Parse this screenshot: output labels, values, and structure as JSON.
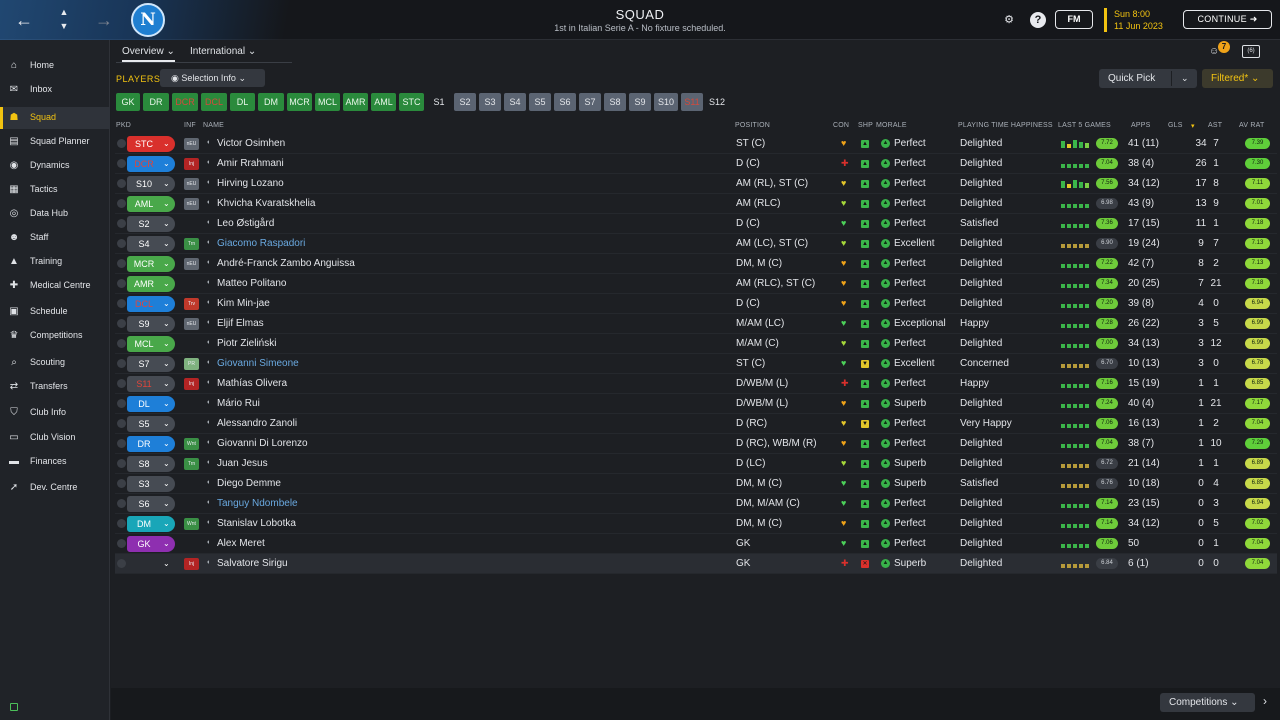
{
  "header": {
    "title": "SQUAD",
    "subtitle": "1st in Italian Serie A - No fixture scheduled.",
    "club_badge": "N",
    "fm_label": "FM",
    "date_time": "Sun 8:00",
    "date_day": "11 Jun 2023",
    "continue_label": "CONTINUE",
    "icons": [
      "back-arrow-icon",
      "up-down-icon",
      "forward-arrow-icon",
      "settings-icon",
      "help-icon"
    ]
  },
  "sidebar": {
    "items": [
      {
        "label": "Home",
        "icon": "⌂"
      },
      {
        "label": "Inbox",
        "icon": "✉"
      },
      {
        "label": "Squad",
        "icon": "☗"
      },
      {
        "label": "Squad Planner",
        "icon": "▤"
      },
      {
        "label": "Dynamics",
        "icon": "◉"
      },
      {
        "label": "Tactics",
        "icon": "▦"
      },
      {
        "label": "Data Hub",
        "icon": "◎"
      },
      {
        "label": "Staff",
        "icon": "☻"
      },
      {
        "label": "Training",
        "icon": "▲"
      },
      {
        "label": "Medical Centre",
        "icon": "✚"
      },
      {
        "label": "Schedule",
        "icon": "▣"
      },
      {
        "label": "Competitions",
        "icon": "♛"
      },
      {
        "label": "Scouting",
        "icon": "⌕"
      },
      {
        "label": "Transfers",
        "icon": "⇄"
      },
      {
        "label": "Club Info",
        "icon": "⛉"
      },
      {
        "label": "Club Vision",
        "icon": "▭"
      },
      {
        "label": "Finances",
        "icon": "▬"
      },
      {
        "label": "Dev. Centre",
        "icon": "➚"
      }
    ],
    "active": "Squad"
  },
  "tabs": {
    "overview": "Overview",
    "international": "International",
    "caret": "⌄"
  },
  "toolbar": {
    "players_label": "PLAYERS",
    "selection_info": "Selection Info",
    "quick_pick": "Quick Pick",
    "filtered": "Filtered*",
    "notification_count": "7",
    "view_label": "(6)"
  },
  "chips": [
    {
      "label": "GK",
      "style": "g"
    },
    {
      "label": "DR",
      "style": "g"
    },
    {
      "label": "DCR",
      "style": "r"
    },
    {
      "label": "DCL",
      "style": "r"
    },
    {
      "label": "DL",
      "style": "g"
    },
    {
      "label": "DM",
      "style": "g"
    },
    {
      "label": "MCR",
      "style": "g"
    },
    {
      "label": "MCL",
      "style": "g"
    },
    {
      "label": "AMR",
      "style": "g"
    },
    {
      "label": "AML",
      "style": "g"
    },
    {
      "label": "STC",
      "style": "g"
    },
    {
      "label": "S1",
      "style": "t"
    },
    {
      "label": "S2",
      "style": "s"
    },
    {
      "label": "S3",
      "style": "s"
    },
    {
      "label": "S4",
      "style": "s"
    },
    {
      "label": "S5",
      "style": "s"
    },
    {
      "label": "S6",
      "style": "s"
    },
    {
      "label": "S7",
      "style": "s"
    },
    {
      "label": "S8",
      "style": "s"
    },
    {
      "label": "S9",
      "style": "s"
    },
    {
      "label": "S10",
      "style": "s"
    },
    {
      "label": "S11",
      "style": "sr"
    },
    {
      "label": "S12",
      "style": "t"
    }
  ],
  "columns": {
    "pkd": "PKD",
    "inf": "INF",
    "name": "NAME",
    "position": "POSITION",
    "con": "CON",
    "shp": "SHP",
    "morale": "MORALE",
    "pth": "PLAYING TIME HAPPINESS",
    "last5": "LAST 5 GAMES",
    "apps": "APPS",
    "gls": "GLS",
    "gls_sort": "▾",
    "ast": "AST",
    "avrat": "AV RAT"
  },
  "colors": {
    "accent_yellow": "#f2c311",
    "pill_red": "#d9302c",
    "pill_green": "#49a84a",
    "pill_blue": "#1e7fd8",
    "pill_grey": "#464b53",
    "pill_teal": "#19a6b8",
    "pill_purple": "#8e2fb0",
    "morale_green": "#38b24a"
  },
  "players": [
    {
      "pkd": "STC",
      "pill": "red",
      "inf": "nEU",
      "inf_c": "#5f6670",
      "name": "Victor Osimhen",
      "loan": false,
      "position": "ST (C)",
      "con": "heart-orange",
      "shp": "up-green",
      "morale": "Perfect",
      "pth": "Delighted",
      "form": "mixed",
      "last5": "7.72",
      "apps": "41 (11)",
      "gls": "34",
      "ast": "7",
      "avrat": "7.39",
      "av_c": "#5fcf3a"
    },
    {
      "pkd": "DCR",
      "pill": "blue-red",
      "inf": "Inj",
      "inf_c": "#b32424",
      "name": "Amir Rrahmani",
      "loan": false,
      "position": "D (C)",
      "con": "cross-red",
      "shp": "up-green",
      "morale": "Perfect",
      "pth": "Delighted",
      "form": "good",
      "last5": "7.04",
      "apps": "38 (4)",
      "gls": "26",
      "ast": "1",
      "avrat": "7.30",
      "av_c": "#5fcf3a"
    },
    {
      "pkd": "S10",
      "pill": "grey",
      "inf": "nEU",
      "inf_c": "#5f6670",
      "name": "Hirving Lozano",
      "loan": false,
      "position": "AM (RL), ST (C)",
      "con": "heart-yellow",
      "shp": "up-green",
      "morale": "Perfect",
      "pth": "Delighted",
      "form": "mixed",
      "last5": "7.56",
      "apps": "34 (12)",
      "gls": "17",
      "ast": "8",
      "avrat": "7.11",
      "av_c": "#8fd83a"
    },
    {
      "pkd": "AML",
      "pill": "green",
      "inf": "nEU",
      "inf_c": "#5f6670",
      "name": "Khvicha Kvaratskhelia",
      "loan": false,
      "position": "AM (RLC)",
      "con": "heart-lime",
      "shp": "up-green",
      "morale": "Perfect",
      "pth": "Delighted",
      "form": "good",
      "last5": "6.98",
      "apps": "43 (9)",
      "gls": "13",
      "ast": "9",
      "avrat": "7.01",
      "av_c": "#8fd83a"
    },
    {
      "pkd": "S2",
      "pill": "grey",
      "inf": "",
      "inf_c": "",
      "name": "Leo Østigård",
      "loan": false,
      "position": "D (C)",
      "con": "heart-green",
      "shp": "up-green",
      "morale": "Perfect",
      "pth": "Satisfied",
      "form": "good",
      "last5": "7.36",
      "apps": "17 (15)",
      "gls": "11",
      "ast": "1",
      "avrat": "7.18",
      "av_c": "#8fd83a"
    },
    {
      "pkd": "S4",
      "pill": "grey",
      "inf": "Trn",
      "inf_c": "#3a8f45",
      "name": "Giacomo Raspadori",
      "loan": true,
      "position": "AM (LC), ST (C)",
      "con": "heart-lime",
      "shp": "up-green",
      "morale": "Excellent",
      "pth": "Delighted",
      "form": "avg",
      "last5": "6.90",
      "apps": "19 (24)",
      "gls": "9",
      "ast": "7",
      "avrat": "7.13",
      "av_c": "#8fd83a"
    },
    {
      "pkd": "MCR",
      "pill": "green",
      "inf": "nEU",
      "inf_c": "#5f6670",
      "name": "André-Franck Zambo Anguissa",
      "loan": false,
      "position": "DM, M (C)",
      "con": "heart-orange",
      "shp": "up-green",
      "morale": "Perfect",
      "pth": "Delighted",
      "form": "good",
      "last5": "7.22",
      "apps": "42 (7)",
      "gls": "8",
      "ast": "2",
      "avrat": "7.13",
      "av_c": "#8fd83a"
    },
    {
      "pkd": "AMR",
      "pill": "green",
      "inf": "",
      "inf_c": "",
      "name": "Matteo Politano",
      "loan": false,
      "position": "AM (RLC), ST (C)",
      "con": "heart-orange",
      "shp": "up-green",
      "morale": "Perfect",
      "pth": "Delighted",
      "form": "good",
      "last5": "7.34",
      "apps": "20 (25)",
      "gls": "7",
      "ast": "21",
      "avrat": "7.18",
      "av_c": "#8fd83a"
    },
    {
      "pkd": "DCL",
      "pill": "blue-red",
      "inf": "Trv",
      "inf_c": "#c0392b",
      "name": "Kim Min-jae",
      "loan": false,
      "position": "D (C)",
      "con": "heart-orange",
      "shp": "up-green",
      "morale": "Perfect",
      "pth": "Delighted",
      "form": "good",
      "last5": "7.20",
      "apps": "39 (8)",
      "gls": "4",
      "ast": "0",
      "avrat": "6.94",
      "av_c": "#c7d94a"
    },
    {
      "pkd": "S9",
      "pill": "grey",
      "inf": "nEU",
      "inf_c": "#5f6670",
      "name": "Eljif Elmas",
      "loan": false,
      "position": "M/AM (LC)",
      "con": "heart-green",
      "shp": "up-green",
      "morale": "Exceptional",
      "pth": "Happy",
      "form": "good",
      "last5": "7.28",
      "apps": "26 (22)",
      "gls": "3",
      "ast": "5",
      "avrat": "6.99",
      "av_c": "#c7d94a"
    },
    {
      "pkd": "MCL",
      "pill": "green",
      "inf": "",
      "inf_c": "",
      "name": "Piotr Zieliński",
      "loan": false,
      "position": "M/AM (C)",
      "con": "heart-lime",
      "shp": "up-green",
      "morale": "Perfect",
      "pth": "Delighted",
      "form": "good",
      "last5": "7.00",
      "apps": "34 (13)",
      "gls": "3",
      "ast": "12",
      "avrat": "6.99",
      "av_c": "#c7d94a"
    },
    {
      "pkd": "S7",
      "pill": "grey",
      "inf": "PR",
      "inf_c": "#7fb27f",
      "name": "Giovanni Simeone",
      "loan": true,
      "position": "ST (C)",
      "con": "heart-green",
      "shp": "down-yellow",
      "morale": "Excellent",
      "pth": "Concerned",
      "form": "avg",
      "last5": "6.70",
      "apps": "10 (13)",
      "gls": "3",
      "ast": "0",
      "avrat": "6.78",
      "av_c": "#c7d94a"
    },
    {
      "pkd": "S11",
      "pill": "grey-red",
      "inf": "Inj",
      "inf_c": "#b32424",
      "name": "Mathías Olivera",
      "loan": false,
      "position": "D/WB/M (L)",
      "con": "cross-red",
      "shp": "up-green",
      "morale": "Perfect",
      "pth": "Happy",
      "form": "good",
      "last5": "7.16",
      "apps": "15 (19)",
      "gls": "1",
      "ast": "1",
      "avrat": "6.85",
      "av_c": "#c7d94a"
    },
    {
      "pkd": "DL",
      "pill": "blue",
      "inf": "",
      "inf_c": "",
      "name": "Mário Rui",
      "loan": false,
      "position": "D/WB/M (L)",
      "con": "heart-orange",
      "shp": "up-green",
      "morale": "Superb",
      "pth": "Delighted",
      "form": "good",
      "last5": "7.24",
      "apps": "40 (4)",
      "gls": "1",
      "ast": "21",
      "avrat": "7.17",
      "av_c": "#8fd83a"
    },
    {
      "pkd": "S5",
      "pill": "grey",
      "inf": "",
      "inf_c": "",
      "name": "Alessandro Zanoli",
      "loan": false,
      "position": "D (RC)",
      "con": "heart-yellow",
      "shp": "down-yellow",
      "morale": "Perfect",
      "pth": "Very Happy",
      "form": "good",
      "last5": "7.06",
      "apps": "16 (13)",
      "gls": "1",
      "ast": "2",
      "avrat": "7.04",
      "av_c": "#8fd83a"
    },
    {
      "pkd": "DR",
      "pill": "blue",
      "inf": "Wnt",
      "inf_c": "#3a8f45",
      "name": "Giovanni Di Lorenzo",
      "loan": false,
      "position": "D (RC), WB/M (R)",
      "con": "heart-orange",
      "shp": "up-green",
      "morale": "Perfect",
      "pth": "Delighted",
      "form": "good",
      "last5": "7.04",
      "apps": "38 (7)",
      "gls": "1",
      "ast": "10",
      "avrat": "7.29",
      "av_c": "#5fcf3a"
    },
    {
      "pkd": "S8",
      "pill": "grey",
      "inf": "Trn",
      "inf_c": "#3a8f45",
      "name": "Juan Jesus",
      "loan": false,
      "position": "D (LC)",
      "con": "heart-lime",
      "shp": "up-green",
      "morale": "Superb",
      "pth": "Delighted",
      "form": "avg",
      "last5": "6.72",
      "apps": "21 (14)",
      "gls": "1",
      "ast": "1",
      "avrat": "6.89",
      "av_c": "#c7d94a"
    },
    {
      "pkd": "S3",
      "pill": "grey",
      "inf": "",
      "inf_c": "",
      "name": "Diego Demme",
      "loan": false,
      "position": "DM, M (C)",
      "con": "heart-green",
      "shp": "up-green",
      "morale": "Superb",
      "pth": "Satisfied",
      "form": "avg",
      "last5": "6.76",
      "apps": "10 (18)",
      "gls": "0",
      "ast": "4",
      "avrat": "6.85",
      "av_c": "#c7d94a"
    },
    {
      "pkd": "S6",
      "pill": "grey",
      "inf": "",
      "inf_c": "",
      "name": "Tanguy Ndombele",
      "loan": true,
      "position": "DM, M/AM (C)",
      "con": "heart-green",
      "shp": "up-green",
      "morale": "Perfect",
      "pth": "Delighted",
      "form": "good",
      "last5": "7.14",
      "apps": "23 (15)",
      "gls": "0",
      "ast": "3",
      "avrat": "6.94",
      "av_c": "#c7d94a"
    },
    {
      "pkd": "DM",
      "pill": "teal",
      "inf": "Wnt",
      "inf_c": "#3a8f45",
      "name": "Stanislav Lobotka",
      "loan": false,
      "position": "DM, M (C)",
      "con": "heart-orange",
      "shp": "up-green",
      "morale": "Perfect",
      "pth": "Delighted",
      "form": "good",
      "last5": "7.14",
      "apps": "34 (12)",
      "gls": "0",
      "ast": "5",
      "avrat": "7.02",
      "av_c": "#8fd83a"
    },
    {
      "pkd": "GK",
      "pill": "purple",
      "inf": "",
      "inf_c": "",
      "name": "Alex Meret",
      "loan": false,
      "position": "GK",
      "con": "heart-green",
      "shp": "up-green",
      "morale": "Perfect",
      "pth": "Delighted",
      "form": "good",
      "last5": "7.06",
      "apps": "50",
      "gls": "0",
      "ast": "1",
      "avrat": "7.04",
      "av_c": "#8fd83a"
    },
    {
      "pkd": "",
      "pill": "none",
      "inf": "Inj",
      "inf_c": "#b32424",
      "name": "Salvatore Sirigu",
      "loan": false,
      "position": "GK",
      "con": "cross-red",
      "shp": "cross-red",
      "morale": "Superb",
      "pth": "Delighted",
      "form": "avg",
      "last5": "6.84",
      "apps": "6 (1)",
      "gls": "0",
      "ast": "0",
      "avrat": "7.04",
      "av_c": "#8fd83a"
    }
  ],
  "bottom": {
    "competitions": "Competitions",
    "next": "›"
  }
}
